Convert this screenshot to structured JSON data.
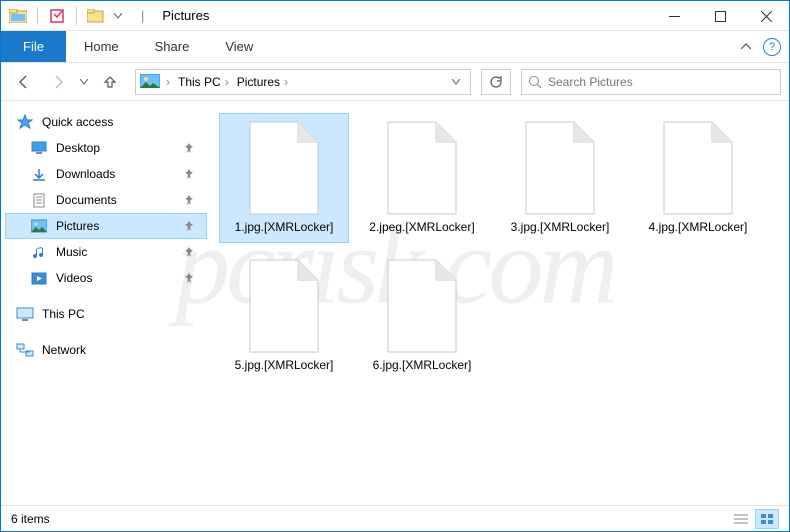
{
  "window": {
    "title": "Pictures",
    "title_sep": "|"
  },
  "ribbon": {
    "file": "File",
    "tabs": [
      "Home",
      "Share",
      "View"
    ]
  },
  "breadcrumb": {
    "items": [
      "This PC",
      "Pictures"
    ]
  },
  "search": {
    "placeholder": "Search Pictures"
  },
  "sidebar": {
    "quick_access": {
      "label": "Quick access",
      "items": [
        {
          "label": "Desktop",
          "icon": "desktop"
        },
        {
          "label": "Downloads",
          "icon": "downloads"
        },
        {
          "label": "Documents",
          "icon": "documents"
        },
        {
          "label": "Pictures",
          "icon": "pictures",
          "selected": true
        },
        {
          "label": "Music",
          "icon": "music"
        },
        {
          "label": "Videos",
          "icon": "videos"
        }
      ]
    },
    "this_pc": {
      "label": "This PC"
    },
    "network": {
      "label": "Network"
    }
  },
  "files": [
    {
      "name": "1.jpg.[XMRLocker]",
      "selected": true
    },
    {
      "name": "2.jpeg.[XMRLocker]"
    },
    {
      "name": "3.jpg.[XMRLocker]"
    },
    {
      "name": "4.jpg.[XMRLocker]"
    },
    {
      "name": "5.jpg.[XMRLocker]"
    },
    {
      "name": "6.jpg.[XMRLocker]"
    }
  ],
  "statusbar": {
    "count_text": "6 items"
  },
  "watermark": "pcrisk.com"
}
